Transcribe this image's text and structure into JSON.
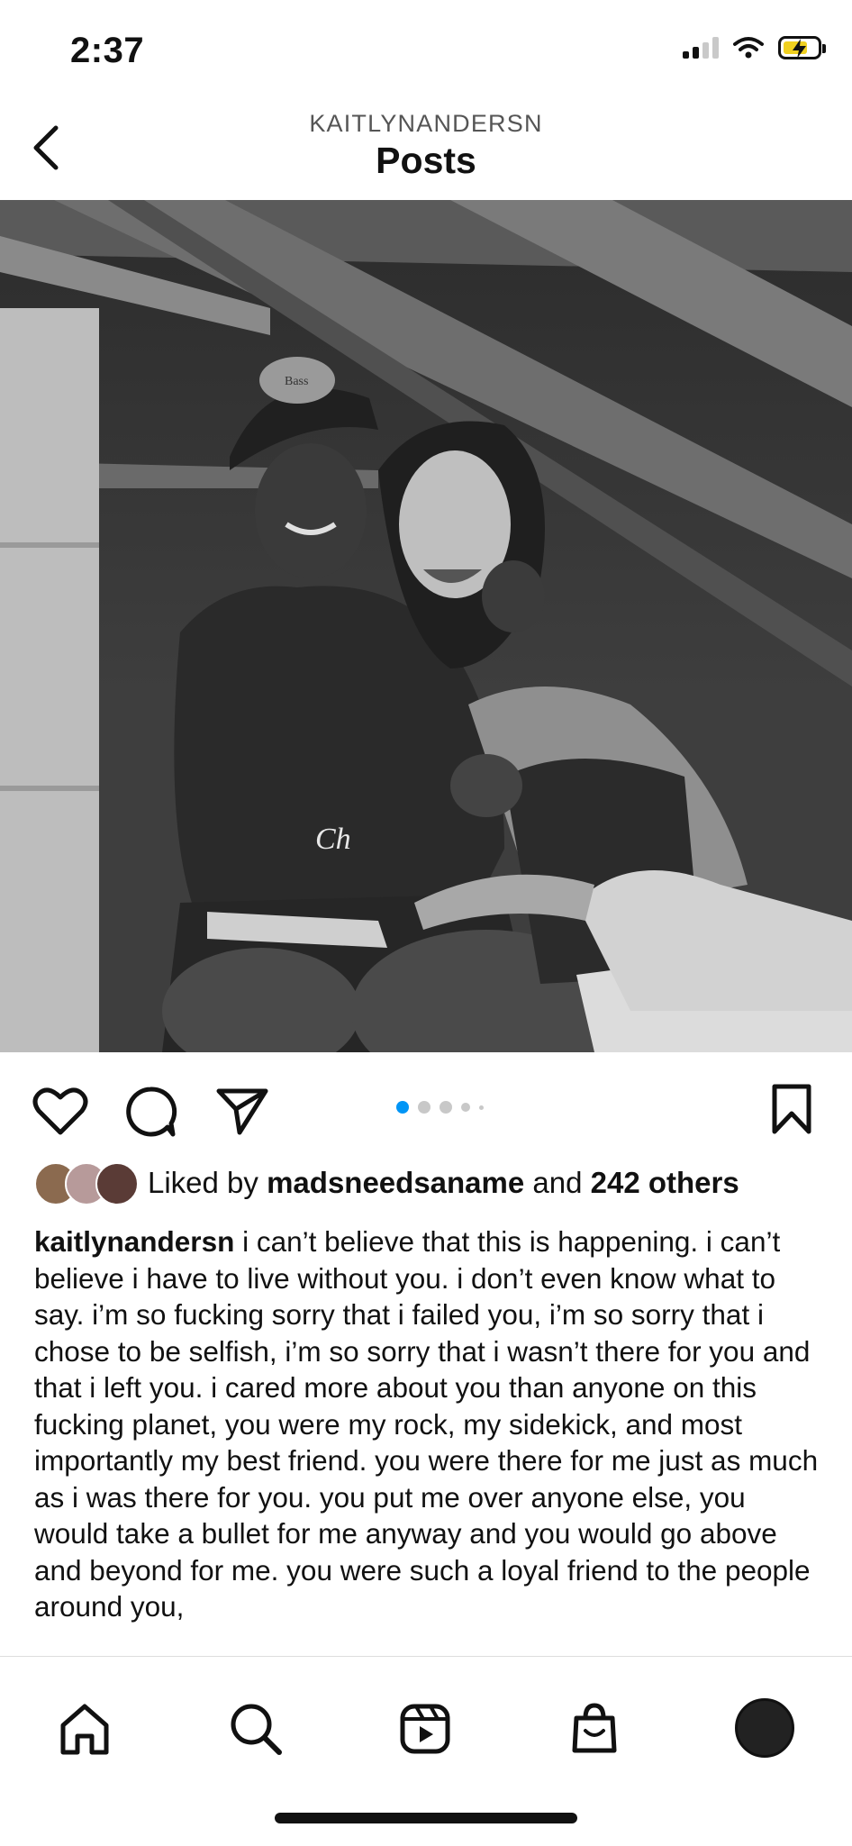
{
  "status_bar": {
    "time": "2:37"
  },
  "header": {
    "username": "KAITLYNANDERSN",
    "title": "Posts"
  },
  "post": {
    "carousel": {
      "count": 5,
      "active_index": 0
    },
    "likes": {
      "prefix": "Liked by ",
      "liked_by": "madsneedsaname",
      "middle": " and ",
      "others": "242 others"
    },
    "caption_username": "kaitlynandersn",
    "caption_text": " i can’t believe that this is happening. i can’t believe i have to live without you. i don’t even know what to say. i’m so fucking sorry that i failed you, i’m so sorry that i chose to be selfish, i’m so sorry that i wasn’t there for you and that i left you. i cared more about you than anyone on this fucking planet, you were my rock, my sidekick, and most importantly my best friend. you were there for me just as much as i was there for you. you put me over anyone else, you would take a bullet for me anyway and you would go above and beyond for me. you were such a loyal friend to the people around you,"
  },
  "icons": {
    "back": "chevron-left-icon",
    "like": "heart-icon",
    "comment": "comment-icon",
    "share": "paper-plane-icon",
    "save": "bookmark-icon",
    "nav": [
      "home-icon",
      "search-icon",
      "reels-icon",
      "shop-icon",
      "profile-avatar"
    ]
  },
  "colors": {
    "accent": "#0095f6",
    "text": "#111111"
  }
}
